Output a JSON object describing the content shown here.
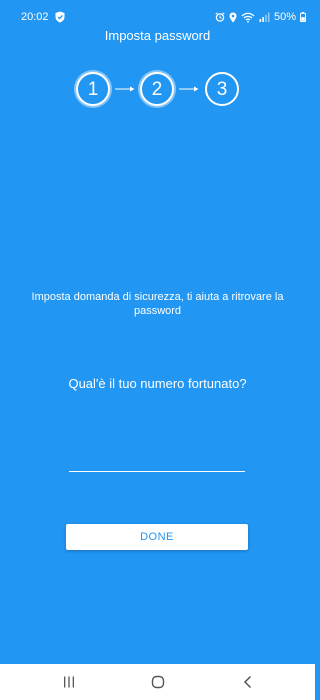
{
  "status_bar": {
    "time": "20:02",
    "battery": "50%"
  },
  "header": {
    "title": "Imposta password"
  },
  "stepper": {
    "steps": [
      {
        "label": "1",
        "state": "done"
      },
      {
        "label": "2",
        "state": "done"
      },
      {
        "label": "3",
        "state": "current"
      }
    ]
  },
  "content": {
    "instruction": "Imposta domanda di sicurezza, ti aiuta a ritrovare la password",
    "question": "Qual'è il tuo numero fortunato?",
    "answer_value": "",
    "done_label": "DONE"
  },
  "colors": {
    "background": "#2196F3",
    "text": "#FFFFFF",
    "button_text": "#2196F3",
    "nav_bar": "#FFFFFF"
  },
  "icons": {
    "status": [
      "shield-icon",
      "alarm-icon",
      "location-icon",
      "wifi-icon",
      "signal-icon",
      "battery-icon"
    ],
    "nav": [
      "recents-icon",
      "home-icon",
      "back-icon"
    ]
  }
}
